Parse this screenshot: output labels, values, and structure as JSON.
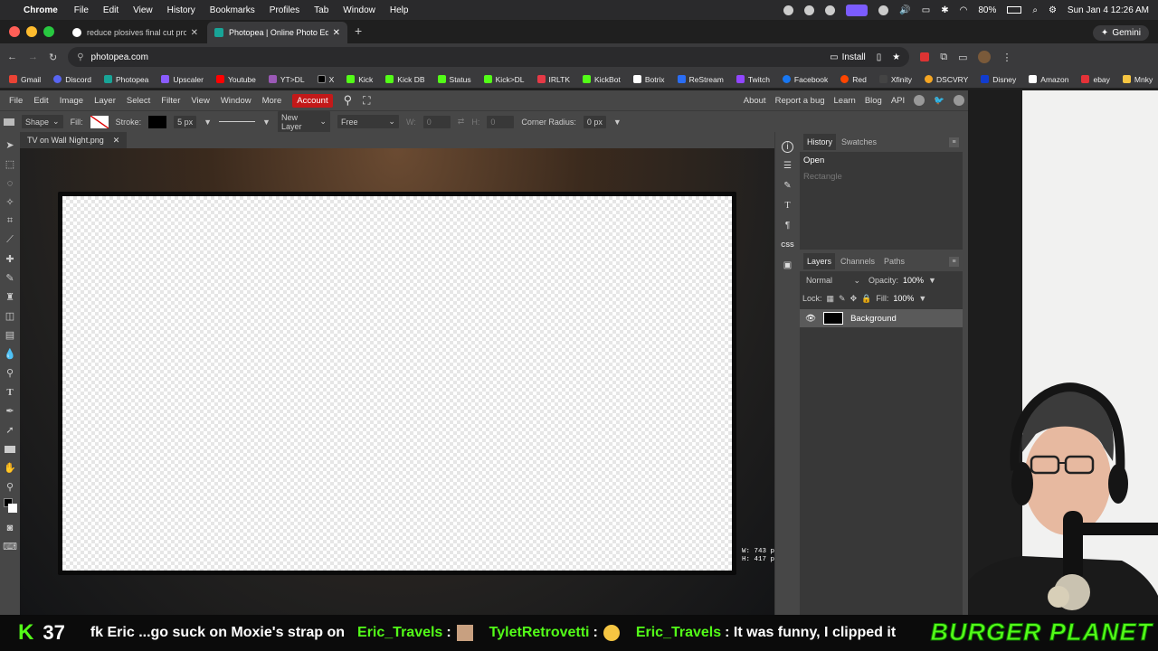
{
  "mac": {
    "apple": "",
    "app": "Chrome",
    "menus": [
      "File",
      "Edit",
      "View",
      "History",
      "Bookmarks",
      "Profiles",
      "Tab",
      "Window",
      "Help"
    ],
    "battery": "80%",
    "datetime": "Sun Jan 4  12:26 AM"
  },
  "browser": {
    "tabs": [
      {
        "title": "reduce plosives final cut pro"
      },
      {
        "title": "Photopea | Online Photo Edito"
      }
    ],
    "url": "photopea.com",
    "install_label": "Install",
    "gemini_label": "Gemini",
    "bookmarks": [
      "Gmail",
      "Discord",
      "Photopea",
      "Upscaler",
      "Youtube",
      "YT>DL",
      "X",
      "Kick",
      "Kick DB",
      "Status",
      "Kick>DL",
      "IRLTK",
      "KickBot",
      "Botrix",
      "ReStream",
      "Twitch",
      "Facebook",
      "Red",
      "Xfinity",
      "DSCVRY",
      "Disney",
      "Amazon",
      "ebay",
      "Mnky"
    ]
  },
  "photopea": {
    "menu": [
      "File",
      "Edit",
      "Image",
      "Layer",
      "Select",
      "Filter",
      "View",
      "Window",
      "More"
    ],
    "account": "Account",
    "right_links": [
      "About",
      "Report a bug",
      "Learn",
      "Blog",
      "API"
    ],
    "options": {
      "shape": "Shape",
      "fill_label": "Fill:",
      "stroke_label": "Stroke:",
      "stroke_size": "5 px",
      "new_layer": "New Layer",
      "free": "Free",
      "w_label": "W:",
      "w_value": "0",
      "h_label": "H:",
      "h_value": "0",
      "corner_label": "Corner Radius:",
      "corner_value": "0 px"
    },
    "document_tab": "TV on Wall Night.png",
    "dims": {
      "w": "W: 743 p",
      "h": "H: 417 p"
    },
    "history": {
      "tabs": [
        "History",
        "Swatches"
      ],
      "items": [
        "Open",
        "Rectangle"
      ]
    },
    "layers": {
      "tabs": [
        "Layers",
        "Channels",
        "Paths"
      ],
      "blend": "Normal",
      "opacity_label": "Opacity:",
      "opacity": "100%",
      "lock_label": "Lock:",
      "fill_label": "Fill:",
      "fill": "100%",
      "items": [
        "Background"
      ]
    }
  },
  "stream": {
    "count": "37",
    "messages": [
      {
        "user": "",
        "text": "fk Eric ...go suck on Moxie's strap on"
      },
      {
        "user": "Eric_Travels",
        "text": ":"
      },
      {
        "user": "TyletRetrovetti",
        "text": ":"
      },
      {
        "user": "Eric_Travels",
        "text": ": It was funny, I clipped it"
      }
    ],
    "logo": "BURGER PLANET"
  },
  "colors": {
    "kick_green": "#53fc18",
    "account_red": "#c31919"
  }
}
